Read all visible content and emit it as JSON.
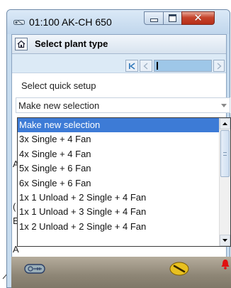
{
  "window": {
    "title": "01:100 AK-CH 650",
    "minimize_icon": "minimize-icon",
    "maximize_icon": "maximize-icon",
    "close_icon": "close-icon"
  },
  "header": {
    "home_icon": "home-icon",
    "page_title": "Select plant type"
  },
  "navigation": {
    "first_icon": "skip-first-icon",
    "prev_icon": "chevron-left-icon",
    "next_icon": "chevron-right-icon"
  },
  "setup": {
    "label": "Select quick setup",
    "selected_value": "Make new selection",
    "dropdown_icon": "chevron-down-icon",
    "options": [
      "Make new selection",
      "3x Single + 4 Fan",
      "4x Single + 4 Fan",
      "5x Single + 6 Fan",
      "6x Single + 6 Fan",
      "1x 1 Unload + 2 Single + 4 Fan",
      "1x 1 Unload + 3 Single + 4 Fan",
      "1x 2 Unload + 2 Single + 4 Fan"
    ],
    "highlighted_index": 0
  },
  "status_bar": {
    "left_icon": "service-tool-icon",
    "mid_icon": "wrench-icon",
    "right_icon": "alarm-bell-icon",
    "colors": {
      "alarm": "#e01010",
      "service": "#e8c020"
    }
  },
  "colors": {
    "selection": "#3d7bd6",
    "titlebar": "#c7dcef",
    "close_button": "#c5442c"
  }
}
